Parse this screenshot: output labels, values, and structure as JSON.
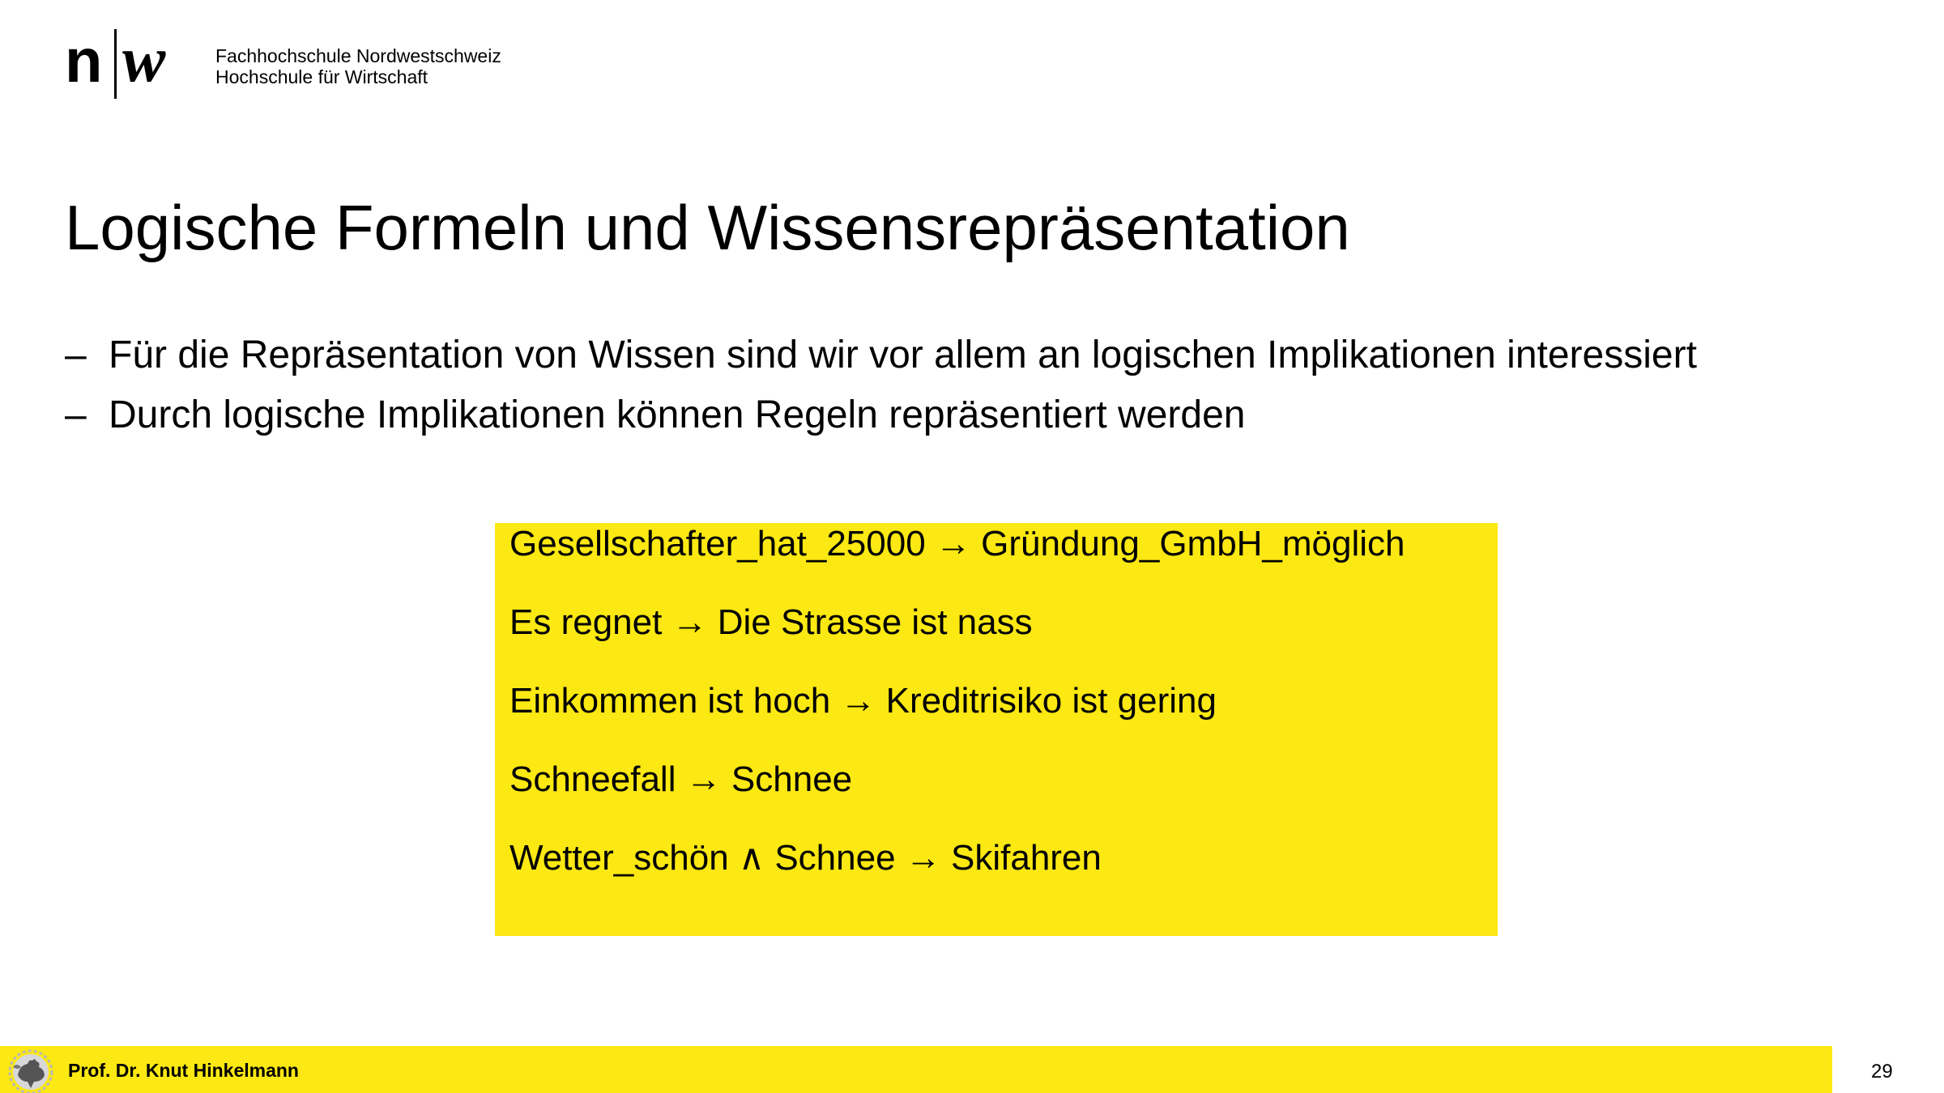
{
  "header": {
    "logo_lines": [
      "Fachhochschule Nordwestschweiz",
      "Hochschule für Wirtschaft"
    ],
    "logo_mark_left": "n",
    "logo_mark_right": "w"
  },
  "title": "Logische Formeln und Wissensrepräsentation",
  "bullets": [
    {
      "dash": "–",
      "text": "Für die Repräsentation von Wissen sind wir vor allem an logischen Implikationen interessiert"
    },
    {
      "dash": "–",
      "text": "Durch logische Implikationen können Regeln repräsentiert werden"
    }
  ],
  "rules": [
    "Gesellschafter_hat_25000 → Gründung_GmbH_möglich",
    "Es regnet → Die Strasse ist nass",
    "Einkommen ist hoch → Kreditrisiko ist gering",
    "Schneefall → Schnee",
    "Wetter_schön ∧ Schnee → Skifahren"
  ],
  "footer": {
    "author": "Prof. Dr. Knut Hinkelmann",
    "page_number": "29",
    "emblem_icon": "rooster-emblem-icon"
  },
  "colors": {
    "accent_yellow": "#fce812",
    "text": "#000000",
    "background": "#ffffff"
  }
}
